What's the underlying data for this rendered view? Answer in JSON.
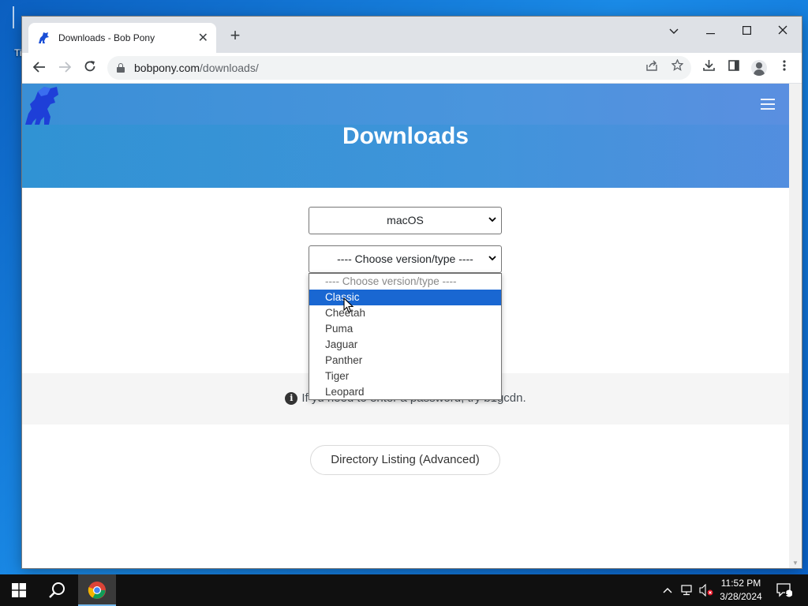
{
  "desktop": {
    "icon_label": "Ti"
  },
  "browser": {
    "tab_title": "Downloads - Bob Pony",
    "tab_close": "✕",
    "new_tab": "+",
    "url_host": "bobpony.com",
    "url_path": "/downloads/",
    "window_controls": {
      "tabsearch": "⌄",
      "minimize": "—",
      "maximize": "☐",
      "close": "✕"
    }
  },
  "page": {
    "title": "Downloads",
    "os_select_value": "macOS",
    "version_select_value": "---- Choose version/type ----",
    "version_options": [
      "---- Choose version/type ----",
      "Classic",
      "Cheetah",
      "Puma",
      "Jaguar",
      "Panther",
      "Tiger",
      "Leopard"
    ],
    "selected_option_index": 1,
    "notice_text": "If you need to enter a password, try b1gcdn.",
    "notice_visible_prefix": "If y",
    "notice_visible_suffix": "u need to enter a password, try b1gcdn.",
    "directory_button": "Directory Listing (Advanced)"
  },
  "taskbar": {
    "time": "11:52 PM",
    "date": "3/28/2024",
    "notification_count": "1"
  },
  "colors": {
    "hero": "#3a8fd6",
    "selected_option": "#1967d2",
    "taskbar": "#101010"
  }
}
